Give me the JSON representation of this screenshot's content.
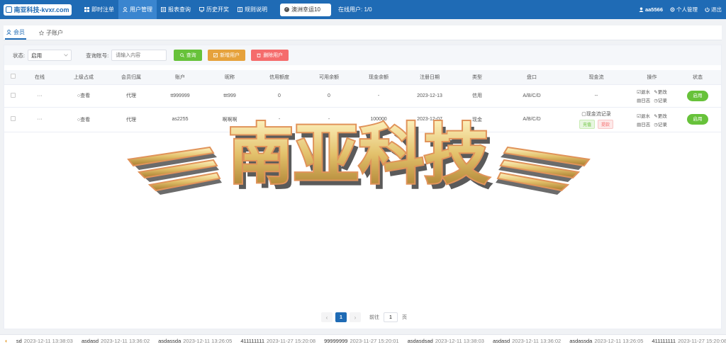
{
  "header": {
    "logo_text": "南亚科技-kvxr.com",
    "nav": [
      {
        "label": "即时注单",
        "icon": "grid-icon"
      },
      {
        "label": "用户管理",
        "icon": "user-icon"
      },
      {
        "label": "报表查询",
        "icon": "report-icon"
      },
      {
        "label": "历史开奖",
        "icon": "monitor-icon"
      },
      {
        "label": "规则说明",
        "icon": "book-icon"
      }
    ],
    "active_nav": "用户管理",
    "game_select": "澳洲幸运10",
    "online": "在线用户: 1/0",
    "user": "aa5566",
    "profile": "个人管理",
    "logout": "退出"
  },
  "tabs": [
    {
      "label": "会员",
      "active": true
    },
    {
      "label": "子账户",
      "active": false
    }
  ],
  "filters": {
    "status_label": "状态:",
    "status_value": "启用",
    "query_label": "查询账号:",
    "query_placeholder": "请输入内容",
    "search_btn": "查询",
    "add_btn": "新增用户",
    "delete_btn": "删除用户"
  },
  "table": {
    "columns": [
      "在线",
      "上级占成",
      "会员归属",
      "账户",
      "昵称",
      "信用额度",
      "可用余额",
      "现金余额",
      "注册日期",
      "类型",
      "盘口",
      "现金流",
      "操作",
      "状态"
    ],
    "rows": [
      {
        "online": "···",
        "superior": "查看",
        "belong": "代理",
        "account": "tt999999",
        "nickname": "ttt999",
        "credit": "0",
        "available": "0",
        "cash": "-",
        "date": "2023-12-13",
        "type": "信用",
        "handicap": "A/B/C/D",
        "cashflow": "--",
        "op_withdraw": "退水",
        "op_modify": "更改",
        "op_log": "日志",
        "op_record": "记录",
        "status": "启用"
      },
      {
        "online": "···",
        "superior": "查看",
        "belong": "代理",
        "account": "as2255",
        "nickname": "啊啊啊",
        "credit": "-",
        "available": "-",
        "cash": "100000",
        "date": "2023-12-07",
        "type": "现金",
        "handicap": "A/B/C/D",
        "cashflow": "现金流记录",
        "cashflow_charge": "充值",
        "cashflow_withdraw": "提款",
        "op_withdraw": "退水",
        "op_modify": "更改",
        "op_log": "日志",
        "op_record": "记录",
        "status": "启用"
      }
    ]
  },
  "watermark_text": "南亚科技",
  "pagination": {
    "prev": "‹",
    "current": "1",
    "next": "›",
    "goto_label": "前往",
    "goto_value": "1",
    "page_suffix": "页"
  },
  "ticker": [
    {
      "name": "sd",
      "time": "2023-12-11 13:38:03"
    },
    {
      "name": "asdasd",
      "time": "2023-12-11 13:36:02"
    },
    {
      "name": "asdassda",
      "time": "2023-12-11 13:26:05"
    },
    {
      "name": "411111111",
      "time": "2023-11-27 15:20:08"
    },
    {
      "name": "99999999",
      "time": "2023-11-27 15:20:01"
    },
    {
      "name": "asdasdsad",
      "time": "2023-12-11 13:38:03"
    },
    {
      "name": "asdasd",
      "time": "2023-12-11 13:36:02"
    },
    {
      "name": "asdassda",
      "time": "2023-12-11 13:26:05"
    },
    {
      "name": "411111111",
      "time": "2023-11-27 15:20:08"
    }
  ],
  "colors": {
    "brand_blue": "#1f6bb5",
    "green": "#67c23a",
    "orange": "#e6a23c",
    "red": "#f56c6c"
  }
}
